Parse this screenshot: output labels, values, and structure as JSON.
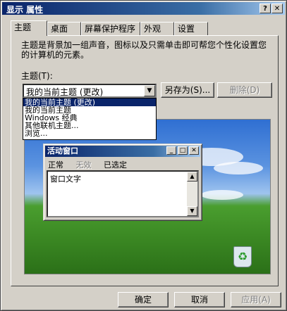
{
  "window": {
    "title": "显示 属性",
    "help_label": "?",
    "close_label": "✕"
  },
  "tabs": [
    {
      "label": "主题"
    },
    {
      "label": "桌面"
    },
    {
      "label": "屏幕保护程序"
    },
    {
      "label": "外观"
    },
    {
      "label": "设置"
    }
  ],
  "theme_page": {
    "description": "主题是背景加一组声音，图标以及只需单击即可帮您个性化设置您的计算机的元素。",
    "theme_label": "主题(T):",
    "selected_value": "我的当前主题 (更改)",
    "dropdown_options": [
      "我的当前主题 (更改)",
      "我的当前主题",
      "Windows 经典",
      "其他联机主题...",
      "浏览..."
    ],
    "saveas_label": "另存为(S)...",
    "delete_label": "删除(D)"
  },
  "preview": {
    "window_title": "活动窗口",
    "menu": {
      "normal": "正常",
      "disabled": "无效",
      "selected": "已选定"
    },
    "window_text": "窗口文字",
    "recycle_icon": "recycle-bin-icon"
  },
  "footer": {
    "ok_label": "确定",
    "cancel_label": "取消",
    "apply_label": "应用(A)"
  },
  "colors": {
    "titlebar": "#0a246a",
    "face": "#d4d0c8",
    "selection": "#0a246a"
  }
}
